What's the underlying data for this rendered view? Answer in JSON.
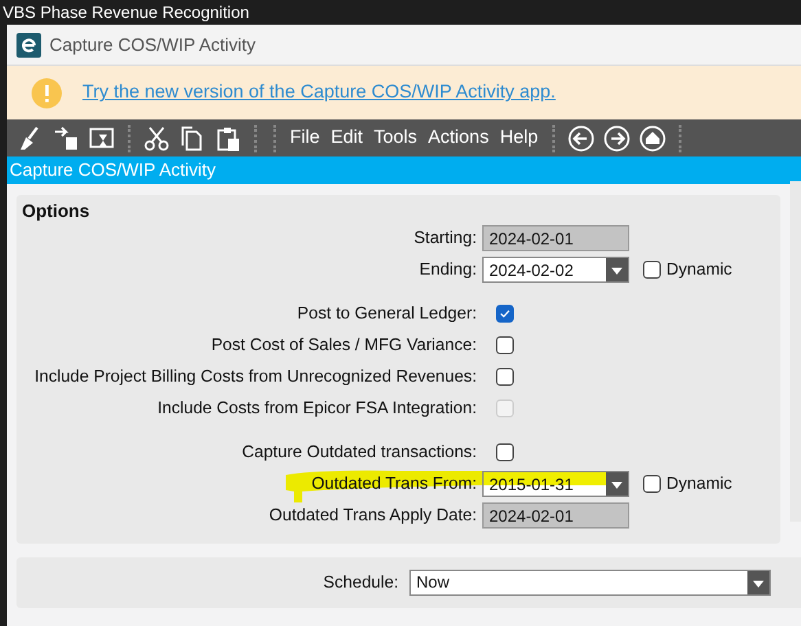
{
  "background_window": {
    "title": "VBS Phase Revenue Recognition"
  },
  "window": {
    "title": "Capture COS/WIP Activity"
  },
  "banner": {
    "link": "Try the new version of the Capture COS/WIP Activity app."
  },
  "menu": [
    "File",
    "Edit",
    "Tools",
    "Actions",
    "Help"
  ],
  "header": "Capture COS/WIP Activity",
  "options": {
    "title": "Options",
    "groups": [
      [
        {
          "kind": "date",
          "label": "Starting:",
          "value": "2024-02-01",
          "readonly": true,
          "highlighted": false
        },
        {
          "kind": "date",
          "label": "Ending:",
          "value": "2024-02-02",
          "readonly": false,
          "highlighted": false,
          "dynamic": {
            "label": "Dynamic",
            "checked": false
          }
        }
      ],
      [
        {
          "kind": "check",
          "label": "Post to General Ledger:",
          "checked": true,
          "disabled": false
        },
        {
          "kind": "check",
          "label": "Post Cost of Sales / MFG Variance:",
          "checked": false,
          "disabled": false
        },
        {
          "kind": "check",
          "label": "Include Project Billing Costs from Unrecognized Revenues:",
          "checked": false,
          "disabled": false
        },
        {
          "kind": "check",
          "label": "Include Costs from Epicor FSA Integration:",
          "checked": false,
          "disabled": true
        }
      ],
      [
        {
          "kind": "check",
          "label": "Capture Outdated transactions:",
          "checked": false,
          "disabled": false
        },
        {
          "kind": "date",
          "label": "Outdated Trans From:",
          "value": "2015-01-31",
          "readonly": false,
          "highlighted": true,
          "dynamic": {
            "label": "Dynamic",
            "checked": false
          }
        },
        {
          "kind": "date",
          "label": "Outdated Trans Apply Date:",
          "value": "2024-02-01",
          "readonly": true,
          "highlighted": false
        }
      ]
    ]
  },
  "schedule": {
    "label": "Schedule:",
    "value": "Now"
  }
}
